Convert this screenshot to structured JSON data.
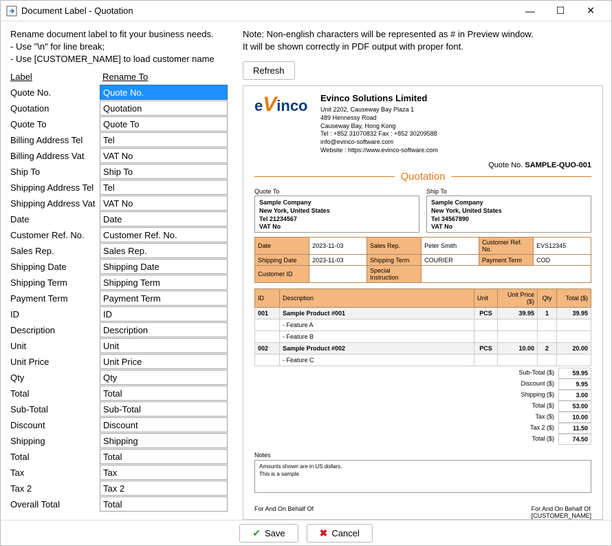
{
  "window": {
    "title": "Document Label - Quotation",
    "minimize": "—",
    "maximize": "☐",
    "close": "✕"
  },
  "leftPanel": {
    "intro1": "Rename document label to fit your business needs.",
    "intro2": "- Use \"\\n\" for line break;",
    "intro3": "- Use [CUSTOMER_NAME] to load customer name",
    "header1": "Label",
    "header2": "Rename To",
    "rows": [
      {
        "label": "Quote No.",
        "value": "Quote No.",
        "selected": true
      },
      {
        "label": "Quotation",
        "value": "Quotation"
      },
      {
        "label": "Quote To",
        "value": "Quote To"
      },
      {
        "label": "Billing Address Tel",
        "value": "Tel"
      },
      {
        "label": "Billing Address Vat",
        "value": "VAT No"
      },
      {
        "label": "Ship To",
        "value": "Ship To"
      },
      {
        "label": "Shipping Address Tel",
        "value": "Tel"
      },
      {
        "label": "Shipping Address Vat",
        "value": "VAT No"
      },
      {
        "label": "Date",
        "value": "Date"
      },
      {
        "label": "Customer Ref. No.",
        "value": "Customer Ref. No."
      },
      {
        "label": "Sales Rep.",
        "value": "Sales Rep."
      },
      {
        "label": "Shipping Date",
        "value": "Shipping Date"
      },
      {
        "label": "Shipping Term",
        "value": "Shipping Term"
      },
      {
        "label": "Payment Term",
        "value": "Payment Term"
      },
      {
        "label": "ID",
        "value": "ID"
      },
      {
        "label": "Description",
        "value": "Description"
      },
      {
        "label": "Unit",
        "value": "Unit"
      },
      {
        "label": "Unit Price",
        "value": "Unit Price"
      },
      {
        "label": "Qty",
        "value": "Qty"
      },
      {
        "label": "Total",
        "value": "Total"
      },
      {
        "label": "Sub-Total",
        "value": "Sub-Total"
      },
      {
        "label": "Discount",
        "value": "Discount"
      },
      {
        "label": "Shipping",
        "value": "Shipping"
      },
      {
        "label": "Total",
        "value": "Total"
      },
      {
        "label": "Tax",
        "value": "Tax"
      },
      {
        "label": "Tax 2",
        "value": "Tax 2"
      },
      {
        "label": "Overall Total",
        "value": "Total"
      }
    ]
  },
  "rightPanel": {
    "note1": "Note: Non-english characters will be represented as # in Preview window.",
    "note2": "It will be shown correctly in PDF output with proper font.",
    "refresh": "Refresh"
  },
  "preview": {
    "company": {
      "name": "Evinco Solutions Limited",
      "addr1": "Unit 2202, Causeway Bay Plaza 1",
      "addr2": "489 Hennessy Road",
      "addr3": "Causeway Bay, Hong Kong",
      "tel": "Tel : +852 31070832      Fax : +852 30209588",
      "email": "info@evinco-software.com",
      "web": "Website : https://www.evinco-software.com"
    },
    "quoteNoLbl": "Quote No.",
    "quoteNo": "SAMPLE-QUO-001",
    "docType": "Quotation",
    "quoteTo": {
      "lbl": "Quote To",
      "l1": "Sample Company",
      "l2": "New York, United States",
      "l3": "Tel 21234567",
      "l4": "VAT No"
    },
    "shipTo": {
      "lbl": "Ship To",
      "l1": "Sample Company",
      "l2": "New York, United States",
      "l3": "Tel 34567890",
      "l4": "VAT No"
    },
    "meta": {
      "dateK": "Date",
      "dateV": "2023-11-03",
      "salesK": "Sales Rep.",
      "salesV": "Peter Smith",
      "custrefK": "Customer Ref. No.",
      "custrefV": "EVS12345",
      "shipdateK": "Shipping Date",
      "shipdateV": "2023-11-03",
      "shiptermK": "Shipping Term",
      "shiptermV": "COURIER",
      "paytermK": "Payment Term",
      "paytermV": "COD",
      "custidK": "Customer ID",
      "specinstK": "Special Instruction"
    },
    "itemsHead": {
      "id": "ID",
      "desc": "Description",
      "unit": "Unit",
      "price": "Unit Price ($)",
      "qty": "Qty",
      "total": "Total ($)"
    },
    "items": [
      {
        "id": "001",
        "desc": "Sample Product #001",
        "unit": "PCS",
        "price": "39.95",
        "qty": "1",
        "total": "39.95",
        "main": true
      },
      {
        "desc": "- Feature A",
        "main": false
      },
      {
        "desc": "- Feature B",
        "main": false
      },
      {
        "id": "002",
        "desc": "Sample Product #002",
        "unit": "PCS",
        "price": "10.00",
        "qty": "2",
        "total": "20.00",
        "main": true
      },
      {
        "desc": "- Feature C",
        "main": false
      }
    ],
    "totals": [
      {
        "l": "Sub-Total ($)",
        "v": "59.95"
      },
      {
        "l": "Discount ($)",
        "v": "9.95"
      },
      {
        "l": "Shipping ($)",
        "v": "3.00"
      },
      {
        "l": "Total ($)",
        "v": "53.00"
      },
      {
        "l": "Tax ($)",
        "v": "10.00"
      },
      {
        "l": "Tax 2 ($)",
        "v": "11.50"
      },
      {
        "l": "Total ($)",
        "v": "74.50"
      }
    ],
    "notesLbl": "Notes",
    "notes1": "Amounts shown are in US dollars.",
    "notes2": "This is a sample.",
    "sigLeft": "For And On Behalf Of",
    "sigRight1": "For And On Behalf Of",
    "sigRight2": "[CUSTOMER_NAME]"
  },
  "bottom": {
    "save": "Save",
    "cancel": "Cancel"
  }
}
